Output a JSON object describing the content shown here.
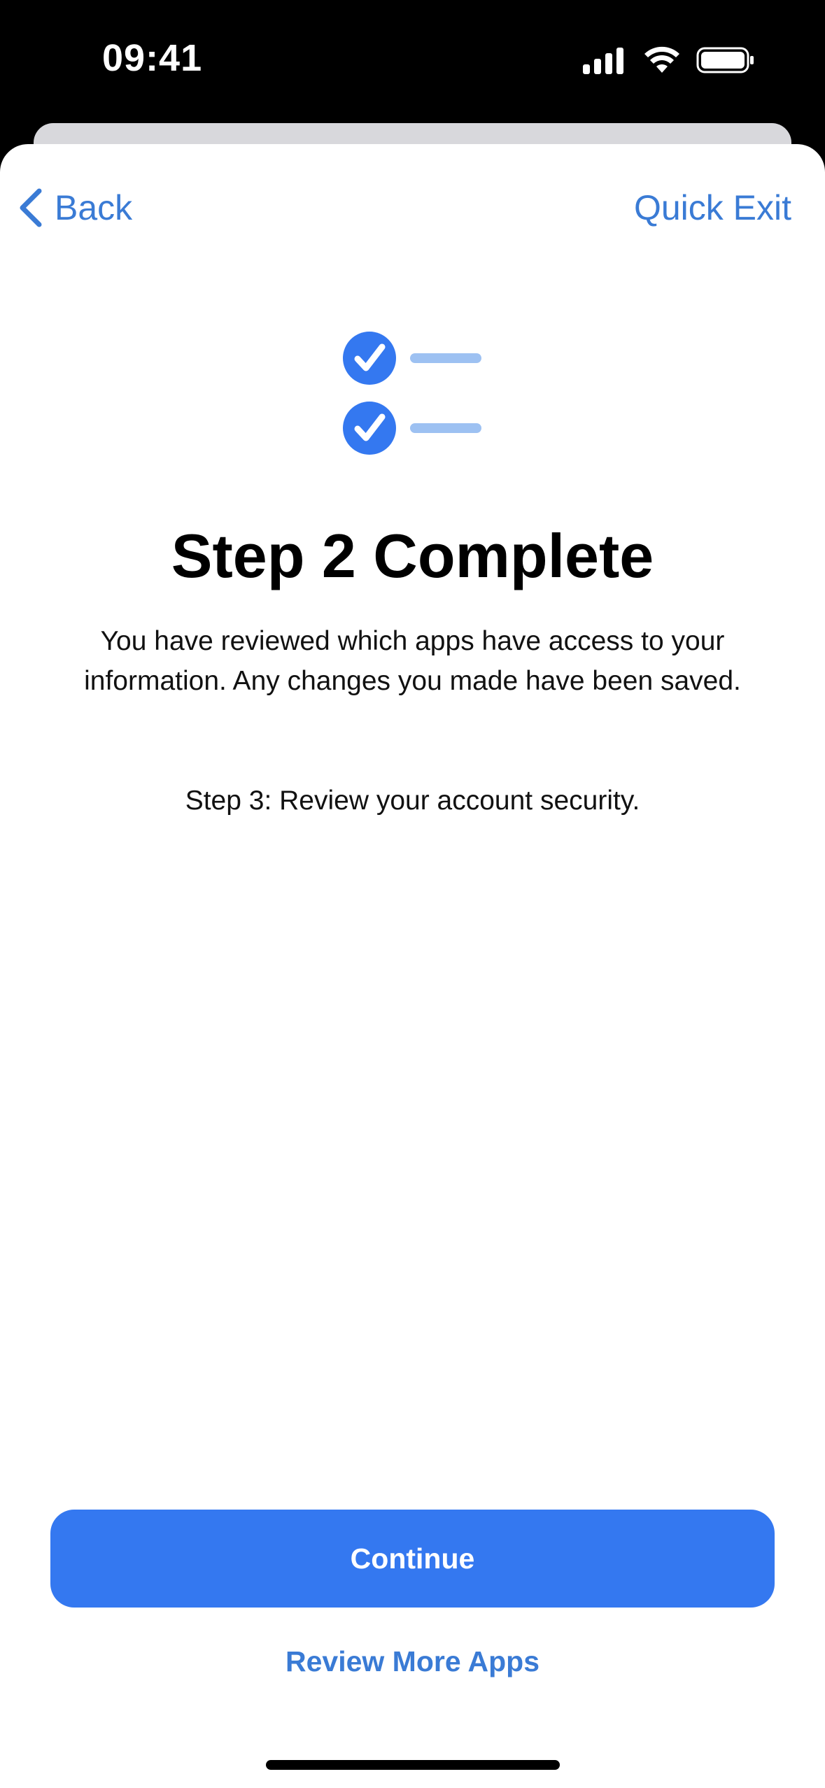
{
  "status_bar": {
    "time": "09:41",
    "icons": [
      "cellular-signal-icon",
      "wifi-icon",
      "battery-icon"
    ]
  },
  "nav": {
    "back_label": "Back",
    "back_icon": "chevron-left-icon",
    "exit_label": "Quick Exit"
  },
  "hero": {
    "icon": "checklist-icon"
  },
  "content": {
    "title": "Step 2 Complete",
    "body": "You have reviewed which apps have access to your information. Any changes you made have been saved.",
    "next_step": "Step 3: Review your account security."
  },
  "actions": {
    "primary_label": "Continue",
    "secondary_label": "Review More Apps"
  },
  "colors": {
    "accent": "#3478f0",
    "link": "#3a7bd5",
    "line_light": "#9dc1f2"
  }
}
